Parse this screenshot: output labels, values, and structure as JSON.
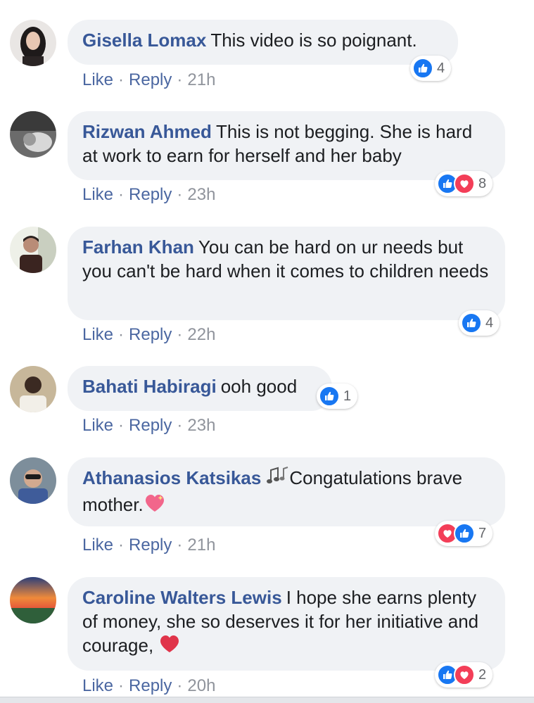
{
  "comments": [
    {
      "author": "Gisella Lomax",
      "text": "This video is so poignant.",
      "like": "Like",
      "reply": "Reply",
      "time": "21h",
      "reaction_count": "4",
      "reactions": [
        "like"
      ]
    },
    {
      "author": "Rizwan Ahmed",
      "text": "This is not begging. She is hard at work to earn for herself and her baby",
      "like": "Like",
      "reply": "Reply",
      "time": "23h",
      "reaction_count": "8",
      "reactions": [
        "like",
        "love"
      ]
    },
    {
      "author": "Farhan Khan",
      "text": "You can be hard on ur needs but you can't be hard when it comes to children needs",
      "like": "Like",
      "reply": "Reply",
      "time": "22h",
      "reaction_count": "4",
      "reactions": [
        "like"
      ]
    },
    {
      "author": "Bahati Habiragi",
      "text": "ooh good",
      "like": "Like",
      "reply": "Reply",
      "time": "23h",
      "reaction_count": "1",
      "reactions": [
        "like"
      ]
    },
    {
      "author": "Athanasios Katsikas",
      "text_before": "Congatulations brave mother.",
      "like": "Like",
      "reply": "Reply",
      "time": "21h",
      "reaction_count": "7",
      "reactions": [
        "love",
        "like"
      ],
      "emojis": [
        "music-notes-emoji",
        "sparkling-heart-emoji"
      ]
    },
    {
      "author": "Caroline Walters Lewis",
      "text": "I hope she earns plenty of money, she so deserves it for her initiative and courage,",
      "like": "Like",
      "reply": "Reply",
      "time": "20h",
      "reaction_count": "2",
      "reactions": [
        "like",
        "love"
      ],
      "emojis": [
        "red-heart-emoji"
      ]
    }
  ],
  "separator": "·",
  "colors": {
    "author": "#385898",
    "bubble": "#f0f2f5",
    "link": "#4b67a1",
    "meta": "#90949c",
    "like_reaction": "#1877f2",
    "love_reaction": "#f33e58"
  },
  "icons": [
    "avatar",
    "like-reaction-icon",
    "love-reaction-icon"
  ]
}
